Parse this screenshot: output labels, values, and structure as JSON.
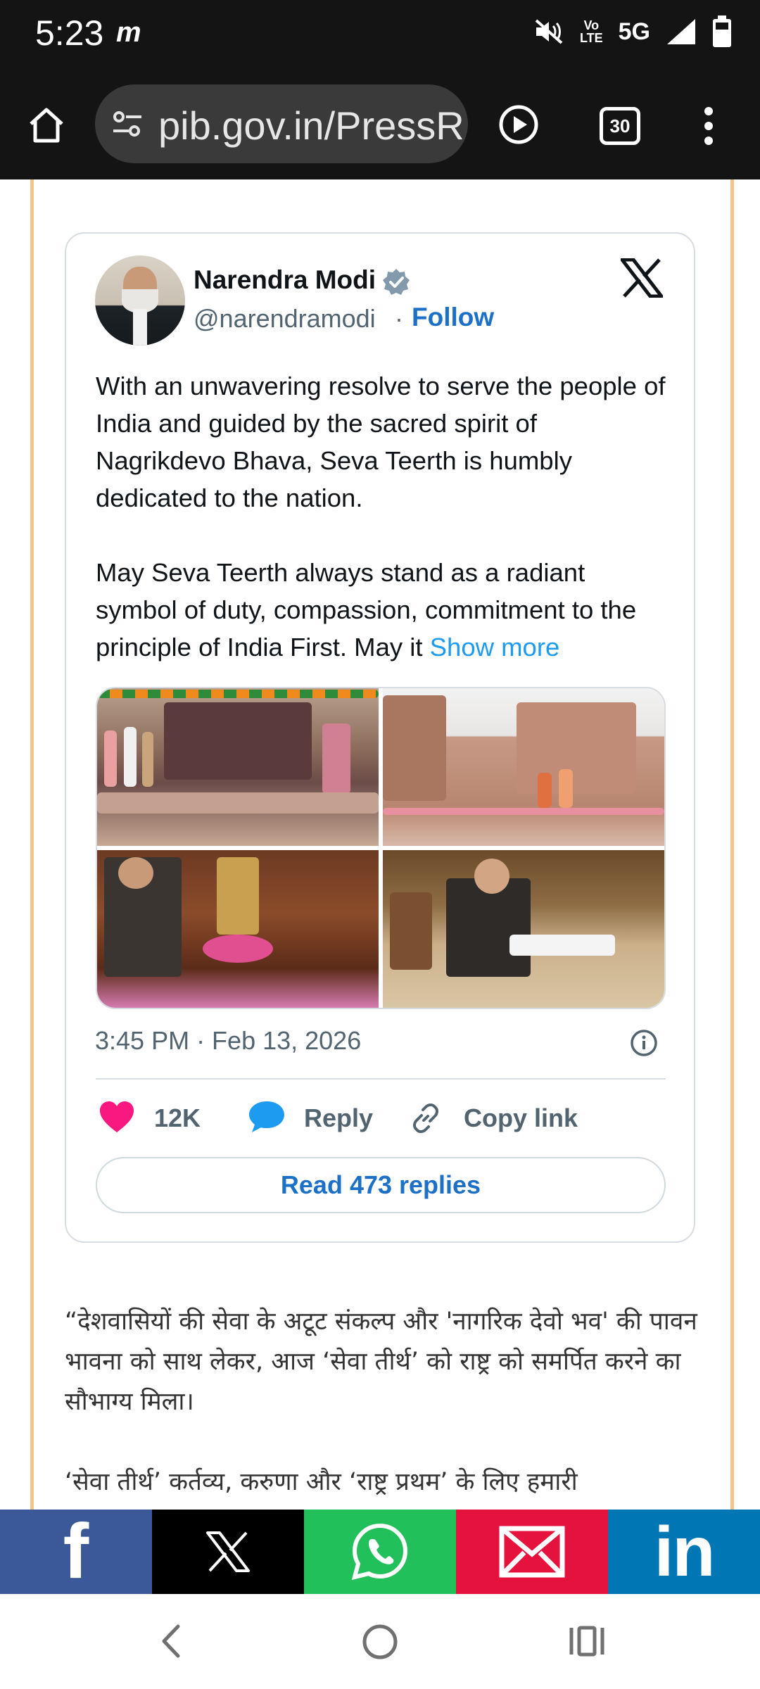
{
  "status_bar": {
    "time": "5:23",
    "notification_letter": "m",
    "network": "5G",
    "volte_line1": "Vo",
    "volte_line2": "LTE"
  },
  "browser": {
    "url": "pib.gov.in/PressR",
    "tab_count": "30"
  },
  "tweet": {
    "author_name": "Narendra Modi",
    "handle": "@narendramodi",
    "separator": "·",
    "follow_label": "Follow",
    "paragraph_1": "With an unwavering resolve to serve the people of India and guided by the sacred spirit of Nagrikdevo Bhava, Seva Teerth is humbly dedicated to the nation.",
    "paragraph_2": "May Seva Teerth always stand as a radiant symbol of duty, compassion, commitment to the principle of India First. May it ",
    "show_more": "Show more",
    "timestamp": "3:45 PM · Feb 13, 2026",
    "like_count": "12K",
    "reply_label": "Reply",
    "copy_link_label": "Copy link",
    "read_replies_label": "Read 473 replies"
  },
  "article": {
    "hindi_paragraph_1": "“देशवासियों की सेवा के अटूट संकल्प और 'नागरिक देवो भव' की पावन भावना को साथ लेकर, आज ‘सेवा तीर्थ’ को राष्ट्र को समर्पित करने का सौभाग्य मिला।",
    "hindi_paragraph_2": "‘सेवा तीर्थ’ कर्तव्य, करुणा और ‘राष्ट्र प्रथम’ के लिए हमारी"
  },
  "share_bar": {
    "facebook_glyph": "f",
    "linkedin_glyph": "in",
    "colors": {
      "facebook": "#3b5998",
      "x": "#000000",
      "whatsapp": "#22c05a",
      "email": "#e5123d",
      "linkedin": "#0077b5"
    }
  },
  "icons": {
    "status": [
      "m-notification-icon",
      "mute-icon",
      "volte-icon",
      "signal-icon",
      "battery-icon"
    ],
    "toolbar": [
      "home-icon",
      "site-settings-icon",
      "play-icon",
      "tab-switcher-icon",
      "more-menu-icon"
    ],
    "tweet": [
      "verified-badge-icon",
      "x-logo-icon",
      "info-icon",
      "heart-icon",
      "reply-bubble-icon",
      "link-icon"
    ],
    "nav": [
      "back-icon",
      "home-circle-icon",
      "recents-icon"
    ]
  },
  "colors": {
    "link_blue": "#1d70c8",
    "show_more_blue": "#1d9bf0",
    "like_pink": "#f91880",
    "reply_blue": "#1d9bf0",
    "frame_accent": "#f2c58c"
  }
}
